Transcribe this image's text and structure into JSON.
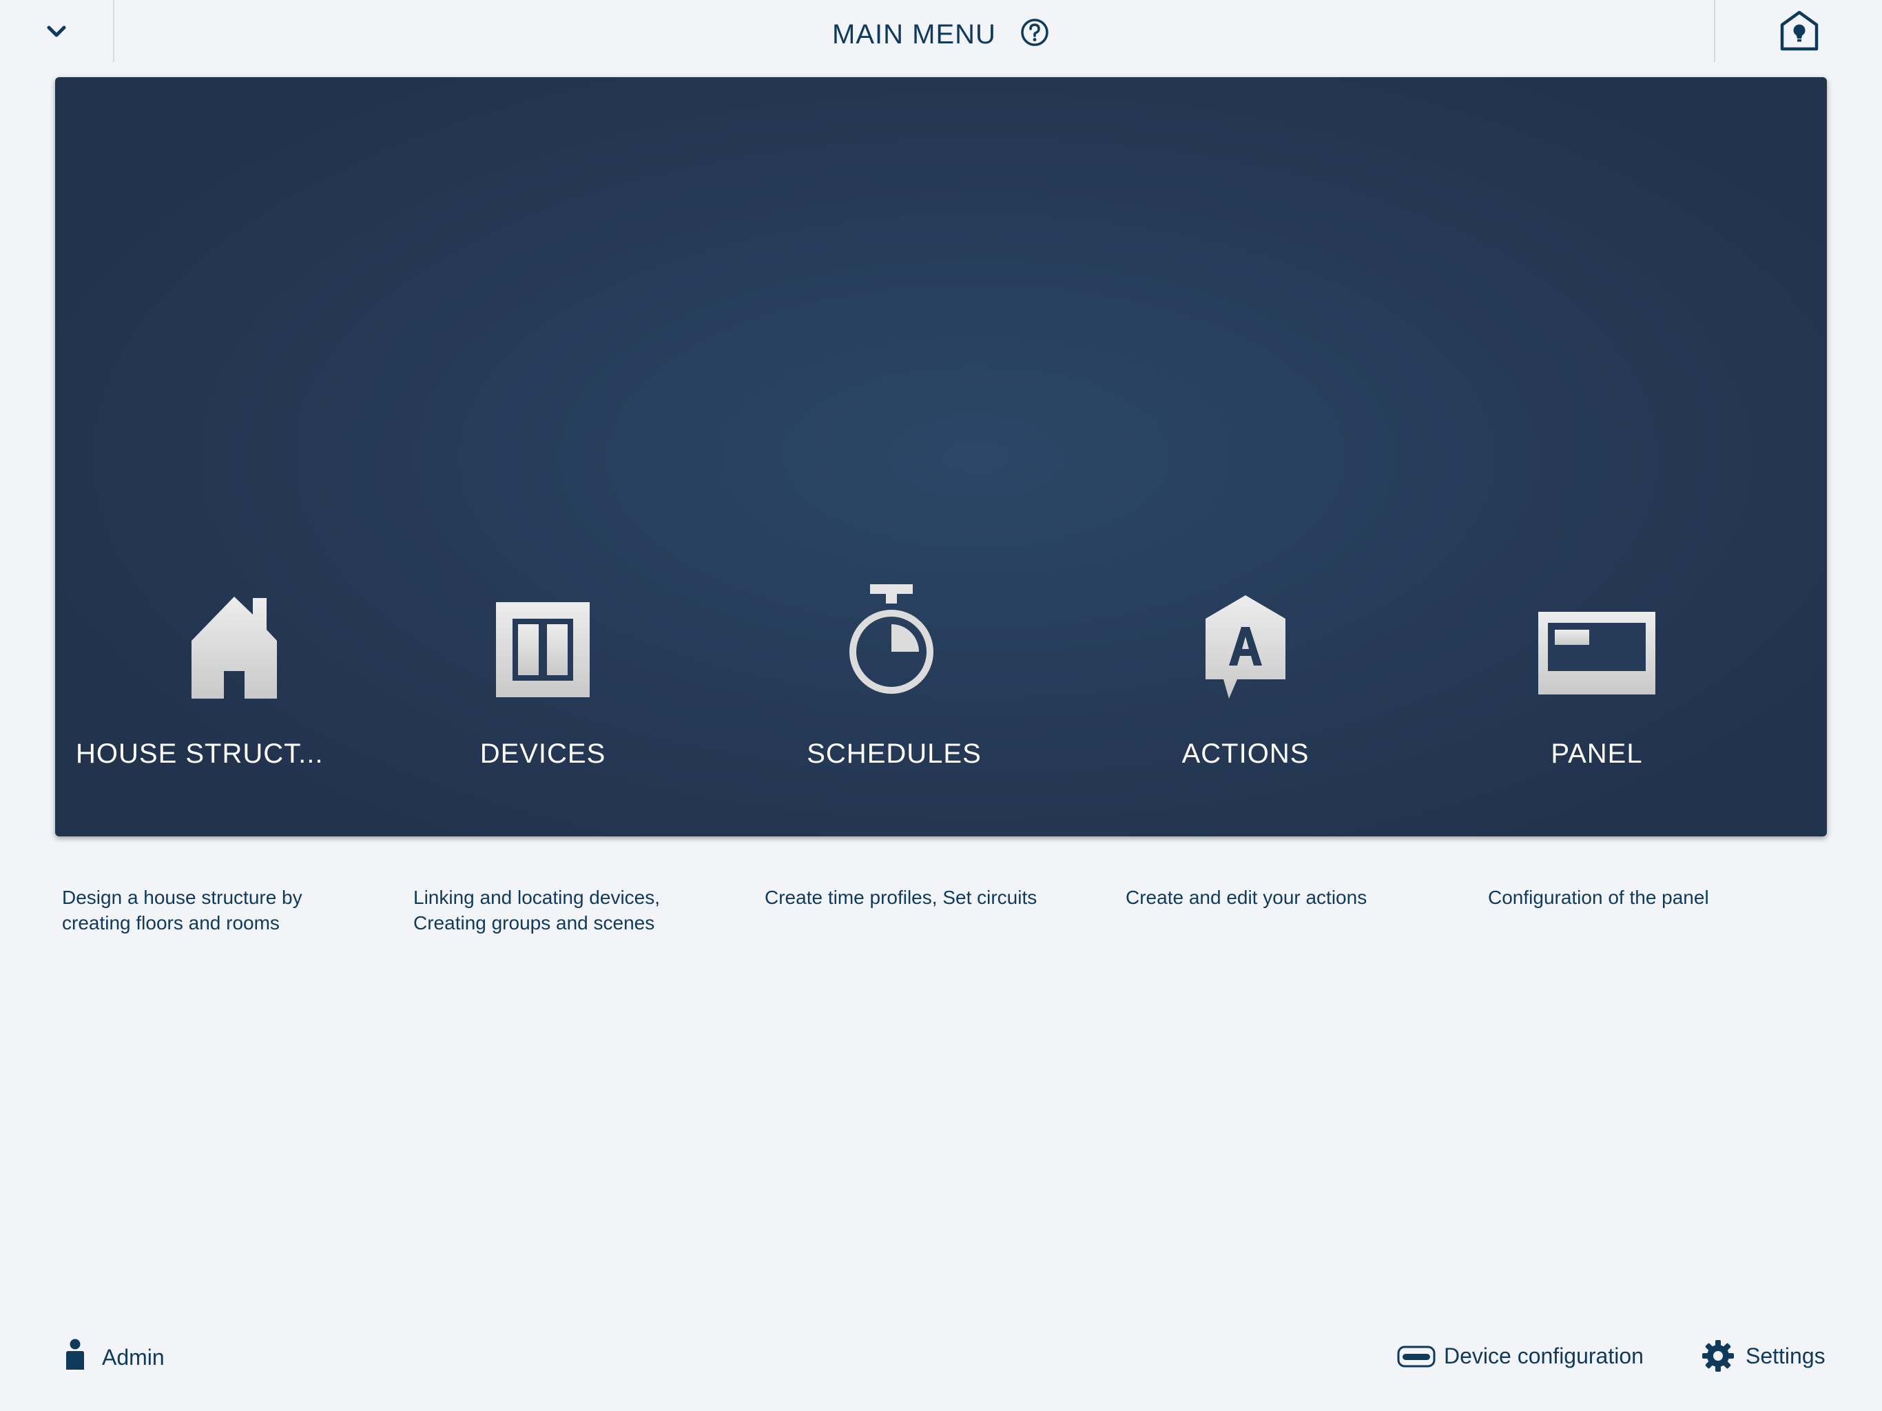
{
  "header": {
    "title": "MAIN MENU",
    "icons": {
      "left": "chevron-down-icon",
      "help": "help-circle-icon",
      "right": "smart-home-icon"
    }
  },
  "tiles": [
    {
      "label": "HOUSE STRUCT...",
      "icon": "house-icon",
      "description": "Design a house structure by creating floors and rooms"
    },
    {
      "label": "DEVICES",
      "icon": "devices-switch-icon",
      "description": "Linking and locating devices, Creating groups and scenes"
    },
    {
      "label": "SCHEDULES",
      "icon": "stopwatch-icon",
      "description": "Create time profiles, Set circuits"
    },
    {
      "label": "ACTIONS",
      "icon": "actions-icon",
      "description": "Create and edit your actions"
    },
    {
      "label": "PANEL",
      "icon": "panel-icon",
      "description": "Configuration of the panel"
    }
  ],
  "footer": {
    "user": {
      "label": "Admin",
      "icon": "user-icon"
    },
    "device_config": {
      "label": "Device configuration",
      "icon": "device-config-icon"
    },
    "settings": {
      "label": "Settings",
      "icon": "gear-icon"
    }
  },
  "colors": {
    "background": "#f2f4f8",
    "banner": "#263b58",
    "text_primary": "#0f3a5c",
    "tile_label": "#ffffff",
    "icon_fill": "#d9d9d9"
  }
}
